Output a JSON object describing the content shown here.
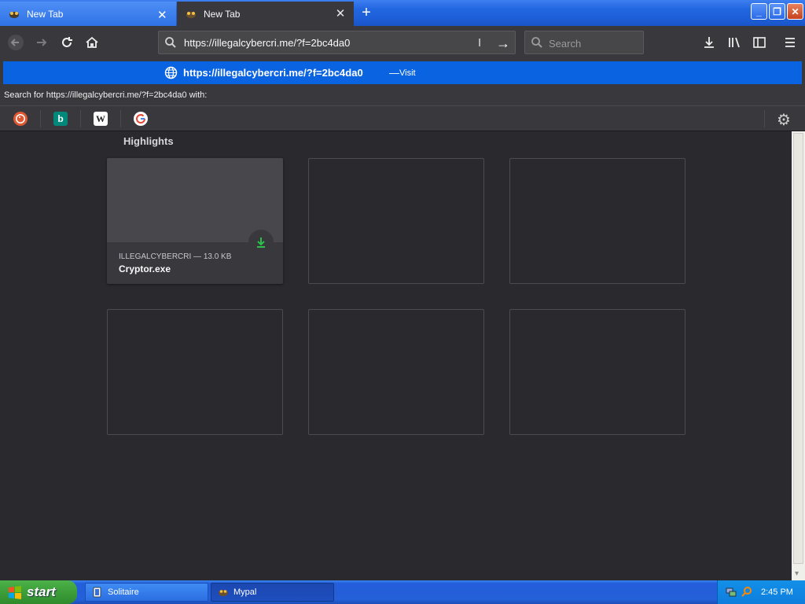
{
  "tabs": [
    {
      "title": "New Tab",
      "active": false
    },
    {
      "title": "New Tab",
      "active": true
    }
  ],
  "urlbar": {
    "value": "https://illegalcybercri.me/?f=2bc4da0"
  },
  "searchbar": {
    "placeholder": "Search"
  },
  "autocomplete": {
    "url": "https://illegalcybercri.me/?f=2bc4da0",
    "separator": "—",
    "action": "Visit",
    "search_with": "Search for https://illegalcybercri.me/?f=2bc4da0 with:",
    "engines": [
      "duckduckgo",
      "bing",
      "wikipedia",
      "google"
    ]
  },
  "highlights": {
    "title": "Highlights",
    "cards": [
      {
        "meta": "ILLEGALCYBERCRI — 13.0 KB",
        "name": "Cryptor.exe",
        "type": "download"
      }
    ]
  },
  "taskbar": {
    "start_label": "start",
    "items": [
      {
        "label": "Solitaire"
      },
      {
        "label": "Mypal"
      }
    ],
    "clock": "2:45 PM"
  },
  "colors": {
    "accent": "#0a63e0",
    "content_bg": "#2a2a2e",
    "toolbar_bg": "#38383d",
    "download_green": "#2ac34a"
  }
}
